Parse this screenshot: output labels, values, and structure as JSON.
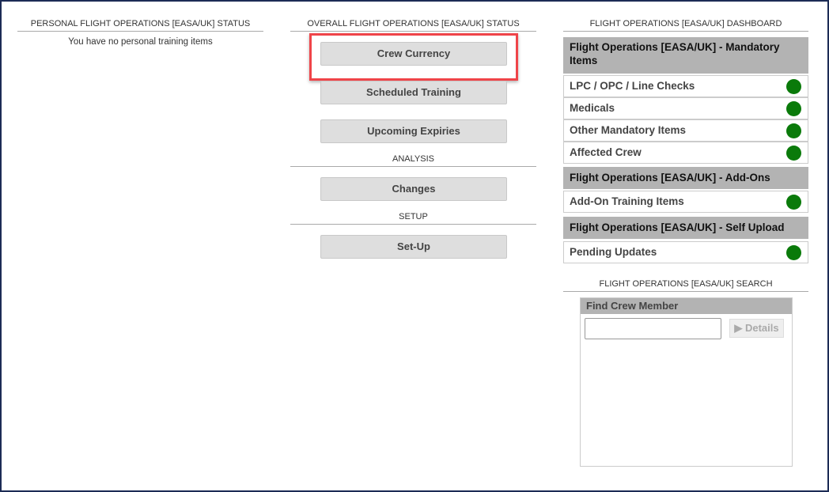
{
  "personal": {
    "title": "PERSONAL FLIGHT OPERATIONS [EASA/UK] STATUS",
    "message": "You have no personal training items"
  },
  "overall": {
    "title": "OVERALL FLIGHT OPERATIONS [EASA/UK] STATUS",
    "buttons": [
      "Crew Currency",
      "Scheduled Training",
      "Upcoming Expiries"
    ],
    "analysis_title": "ANALYSIS",
    "analysis_button": "Changes",
    "setup_title": "SETUP",
    "setup_button": "Set-Up"
  },
  "dashboard": {
    "title": "FLIGHT OPERATIONS [EASA/UK] DASHBOARD",
    "status_color": "#0a7a0a",
    "groups": [
      {
        "title": "Flight Operations [EASA/UK] - Mandatory Items",
        "items": [
          "LPC / OPC / Line Checks",
          "Medicals",
          "Other Mandatory Items",
          "Affected Crew"
        ]
      },
      {
        "title": "Flight Operations [EASA/UK] - Add-Ons",
        "items": [
          "Add-On Training Items"
        ]
      },
      {
        "title": "Flight Operations [EASA/UK] - Self Upload",
        "items": [
          "Pending Updates"
        ]
      }
    ]
  },
  "search": {
    "title": "FLIGHT OPERATIONS [EASA/UK] SEARCH",
    "box_title": "Find Crew Member",
    "input_value": "",
    "details_label": "Details",
    "details_icon": "play-icon"
  },
  "highlight_color": "#ef4449"
}
